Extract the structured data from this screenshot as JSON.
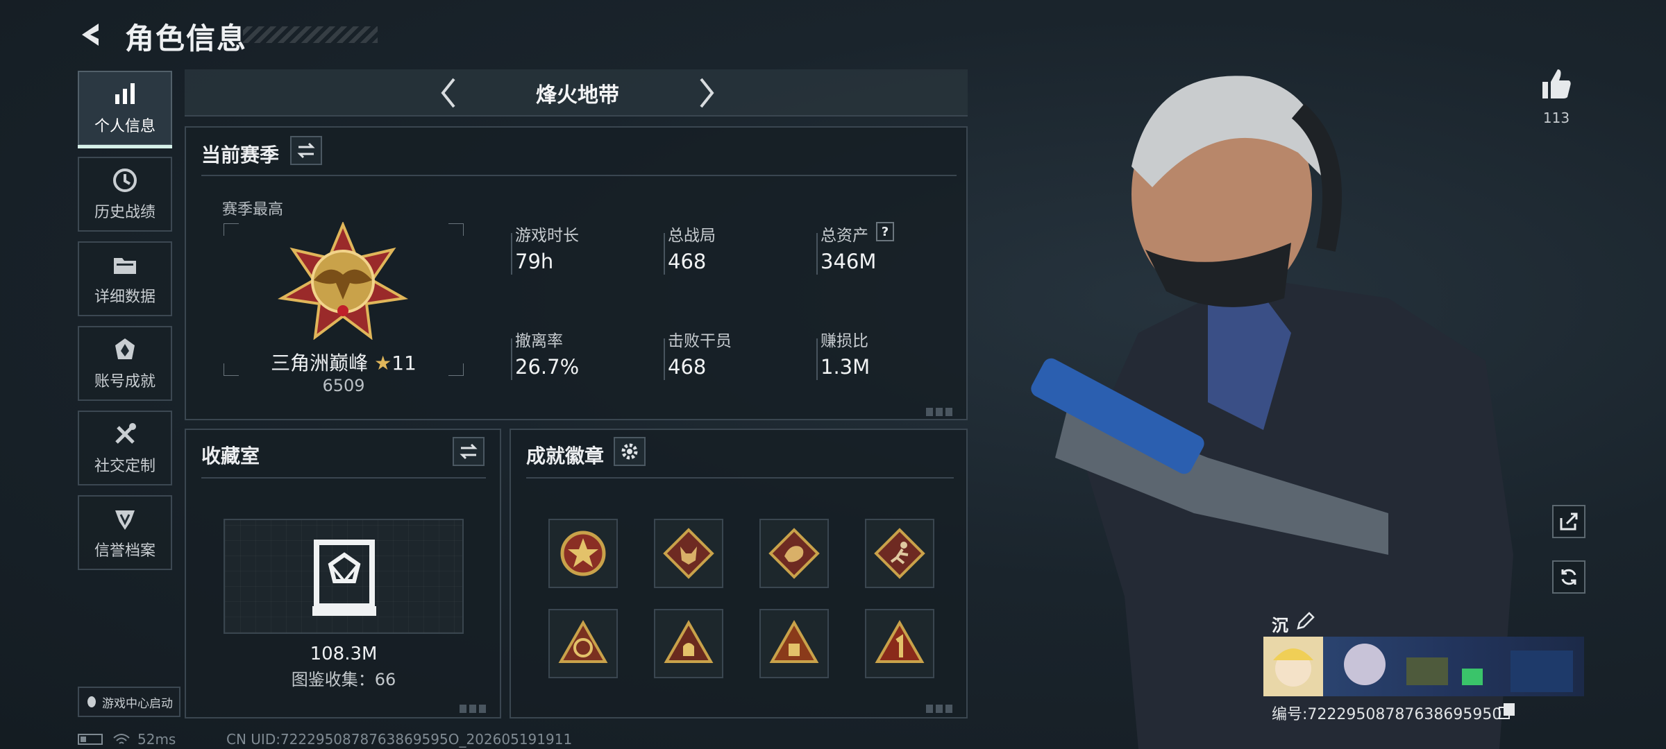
{
  "header": {
    "title": "角色信息"
  },
  "sidebar": {
    "items": [
      {
        "label": "个人信息",
        "icon": "bar-chart-icon",
        "active": true
      },
      {
        "label": "历史战绩",
        "icon": "history-clock-icon",
        "active": false
      },
      {
        "label": "详细数据",
        "icon": "folder-icon",
        "active": false
      },
      {
        "label": "账号成就",
        "icon": "achievement-icon",
        "active": false
      },
      {
        "label": "社交定制",
        "icon": "tools-icon",
        "active": false
      },
      {
        "label": "信誉档案",
        "icon": "shield-rank-icon",
        "active": false
      }
    ],
    "launch_button": "游戏中心启动"
  },
  "mode_bar": {
    "name": "烽火地带"
  },
  "season": {
    "title": "当前赛季",
    "best_label": "赛季最高",
    "rank_name": "三角洲巅峰",
    "rank_stars": "11",
    "rank_score": "6509",
    "stats": [
      {
        "label": "游戏时长",
        "value": "79h"
      },
      {
        "label": "总战局",
        "value": "468"
      },
      {
        "label": "总资产",
        "value": "346M",
        "help": "?"
      },
      {
        "label": "撤离率",
        "value": "26.7%"
      },
      {
        "label": "击败干员",
        "value": "468"
      },
      {
        "label": "赚损比",
        "value": "1.3M"
      }
    ]
  },
  "collection": {
    "title": "收藏室",
    "value": "108.3M",
    "count_label": "图鉴收集：66"
  },
  "medals": {
    "title": "成就徽章",
    "items": [
      "star-medal-icon",
      "wolf-medal-icon",
      "dragon-medal-icon",
      "runner-medal-icon",
      "ring-triangle-medal-icon",
      "bag-triangle-medal-icon",
      "crate-triangle-medal-icon",
      "number-one-medal-icon"
    ]
  },
  "status": {
    "ping": "52ms",
    "uid": "CN UID:7222950878763869595O_202605191911"
  },
  "right": {
    "like_count": "113",
    "card_name": "沉",
    "card_id": "编号:72229508787638695950"
  },
  "colors": {
    "accent": "#d6f0e8",
    "panel_border": "#3a4650",
    "gold": "#c9a24a"
  }
}
